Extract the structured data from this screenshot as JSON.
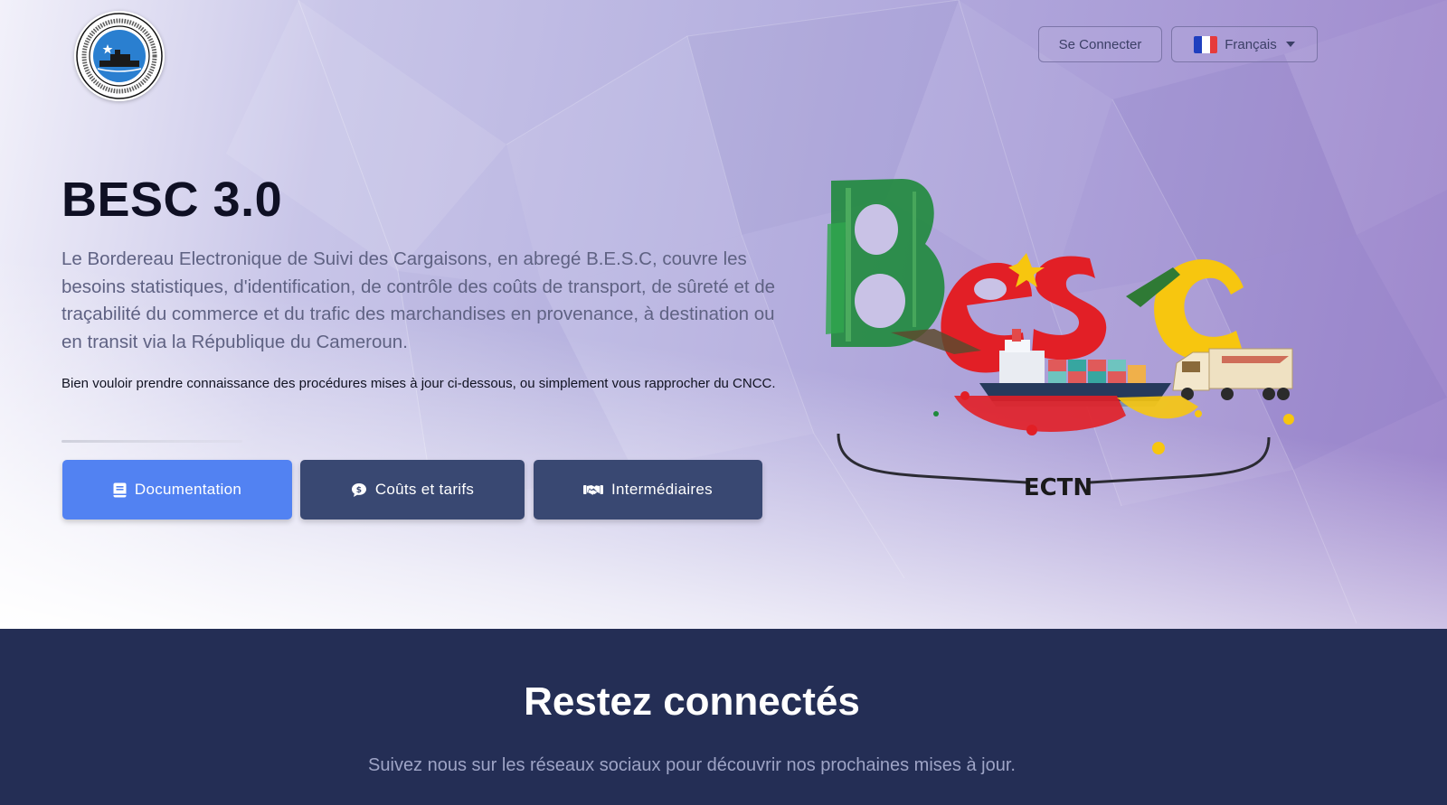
{
  "header": {
    "logo_text": "CONSEIL NATIONAL DES CHARGEURS DU CAMEROUN · CAMEROON NATIONAL SHIPPERS' COUNCIL",
    "login_label": "Se Connecter",
    "language_label": "Français"
  },
  "hero": {
    "title": "BESC 3.0",
    "lead": "Le Bordereau Electronique de Suivi des Cargaisons, en abregé B.E.S.C, couvre les besoins statistiques, d'identification, de contrôle des coûts de transport, de sûreté et de traçabilité du commerce et du trafic des marchandises en provenance, à destination ou en transit via la République du Cameroun.",
    "note": "Bien vouloir prendre connaissance des procédures mises à jour ci-dessous, ou simplement vous rapprocher du CNCC.",
    "buttons": [
      {
        "label": "Documentation",
        "icon": "book-icon"
      },
      {
        "label": "Coûts et tarifs",
        "icon": "comment-dollar-icon"
      },
      {
        "label": "Intermédiaires",
        "icon": "handshake-icon"
      }
    ],
    "illustration_label": "ECTN"
  },
  "social": {
    "title": "Restez connectés",
    "subtitle": "Suivez nous sur les réseaux sociaux pour découvrir nos prochaines mises à jour."
  },
  "colors": {
    "primary_button": "#5282f2",
    "secondary_button": "#394872",
    "dark_section": "#242e55",
    "flag_blue": "#1f3fbf",
    "flag_white": "#ffffff",
    "flag_red": "#e63b3b"
  }
}
